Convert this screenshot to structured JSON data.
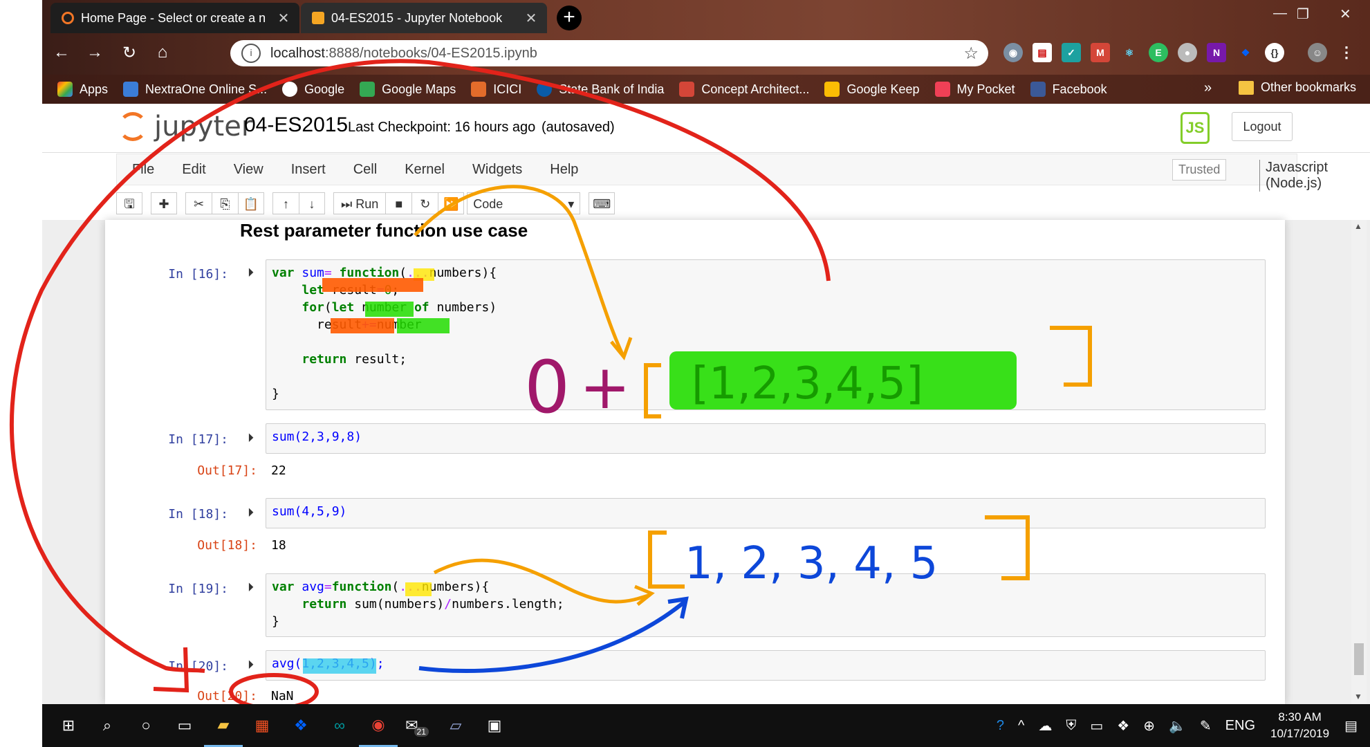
{
  "browser": {
    "tabs": [
      {
        "title": "Home Page - Select or create a n",
        "close": "✕",
        "icon_color": "#f37626"
      },
      {
        "title": "04-ES2015 - Jupyter Notebook",
        "close": "✕",
        "icon_color": "#f5a623"
      }
    ],
    "new_tab": "+",
    "address_host": "localhost",
    "address_path": ":8888/notebooks/04-ES2015.ipynb",
    "bookmarks": [
      {
        "label": "Apps",
        "icon_color": "#e94235"
      },
      {
        "label": "NextraOne Online S...",
        "icon_color": "#3b7dd8"
      },
      {
        "label": "Google",
        "icon_color": "#ffffff"
      },
      {
        "label": "Google Maps",
        "icon_color": "#34a853"
      },
      {
        "label": "ICICI",
        "icon_color": "#e36c2b"
      },
      {
        "label": "State Bank of India",
        "icon_color": "#0a5ca8"
      },
      {
        "label": "Concept Architect...",
        "icon_color": "#d44638"
      },
      {
        "label": "Google Keep",
        "icon_color": "#fbbc04"
      },
      {
        "label": "My Pocket",
        "icon_color": "#ef4056"
      },
      {
        "label": "Facebook",
        "icon_color": "#3b5998"
      }
    ],
    "bookmarks_more": "»",
    "other_bookmarks": "Other bookmarks"
  },
  "jupyter": {
    "logo_text": "jupyter",
    "notebook_title": "04-ES2015",
    "checkpoint": "Last Checkpoint: 16 hours ago",
    "autosaved": "(autosaved)",
    "nodejs_badge": "JS",
    "logout": "Logout",
    "menu": [
      "File",
      "Edit",
      "View",
      "Insert",
      "Cell",
      "Kernel",
      "Widgets",
      "Help"
    ],
    "trusted": "Trusted",
    "kernel": "Javascript (Node.js)",
    "toolbar": {
      "run_label": "Run",
      "cell_type": "Code"
    }
  },
  "notebook": {
    "heading": "Rest parameter function use case",
    "cells": [
      {
        "in": "In [16]:"
      },
      {
        "in": "In [17]:",
        "out": "Out[17]:",
        "output": "22"
      },
      {
        "in": "In [18]:",
        "out": "Out[18]:",
        "output": "18"
      },
      {
        "in": "In [19]:"
      },
      {
        "in": "In [20]:",
        "out": "Out[20]:",
        "output": "NaN"
      }
    ],
    "code": {
      "c16": [
        "var sum= function(...numbers){",
        "    let result=0;",
        "    for(let number of numbers)",
        "      result+=number",
        "",
        "    return result;",
        "",
        "}"
      ],
      "c17": "sum(2,3,9,8)",
      "c18": "sum(4,5,9)",
      "c19": [
        "var avg=function(...numbers){",
        "    return sum(numbers)/numbers.length;",
        "}"
      ],
      "c20": "avg(1,2,3,4,5);"
    }
  },
  "annotations": {
    "expr_top_zero": "0",
    "expr_top_plus": "+",
    "expr_top_inner": "[1,2,3,4,5]",
    "expr_mid": "1, 2, 3, 4, 5"
  },
  "taskbar": {
    "lang": "ENG",
    "time": "8:30 AM",
    "date": "10/17/2019",
    "mail_badge": "21"
  }
}
